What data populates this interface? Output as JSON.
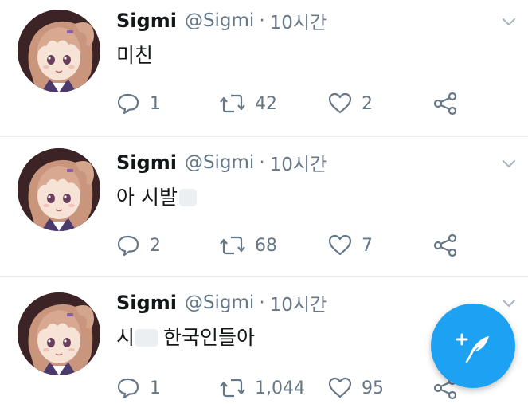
{
  "tweets": [
    {
      "name": "Sigmi",
      "handle": "@Sigmi",
      "separator": "·",
      "time": "10시간",
      "text": "미친",
      "censored": false,
      "replies": "1",
      "retweets": "42",
      "likes": "2"
    },
    {
      "name": "Sigmi",
      "handle": "@Sigmi",
      "separator": "·",
      "time": "10시간",
      "text": "아 시발",
      "censored": true,
      "replies": "2",
      "retweets": "68",
      "likes": "7"
    },
    {
      "name": "Sigmi",
      "handle": "@Sigmi",
      "separator": "·",
      "time": "10시간",
      "text_prefix": "시",
      "text": "한국인들아",
      "censored": true,
      "replies": "1",
      "retweets": "1,044",
      "likes": "95"
    }
  ],
  "icons": {
    "reply": "reply-icon",
    "retweet": "retweet-icon",
    "like": "heart-icon",
    "share": "share-icon",
    "menu": "chevron-down-icon",
    "compose": "compose-tweet-icon"
  },
  "colors": {
    "accent": "#1da1f2",
    "secondary_text": "#657786",
    "primary_text": "#14171a",
    "divider": "#e6ecf0"
  }
}
